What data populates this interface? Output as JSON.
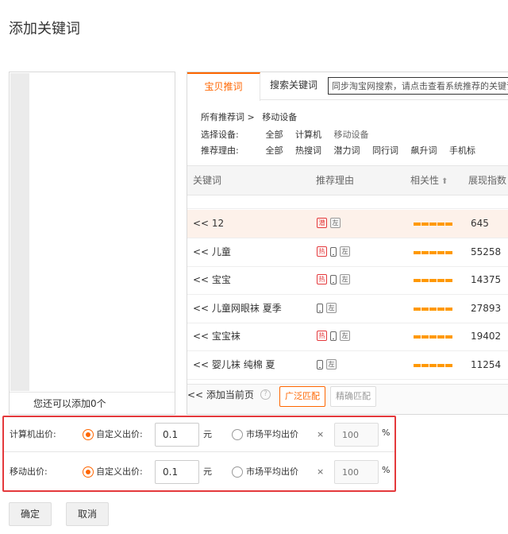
{
  "dialog": {
    "title": "添加关键词"
  },
  "left": {
    "footer": "您还可以添加0个"
  },
  "tabs": [
    {
      "label": "宝贝推词"
    },
    {
      "label": "搜索关键词"
    }
  ],
  "search": {
    "value": "同步淘宝网搜索，请点击查看系统推荐的关键词"
  },
  "filters": {
    "crumb_root": "所有推荐词 >",
    "crumb_current": "移动设备",
    "device_label": "选择设备:",
    "device_options": [
      "全部",
      "计算机",
      "移动设备"
    ],
    "reason_label": "推荐理由:",
    "reason_options": [
      "全部",
      "热搜词",
      "潜力词",
      "同行词",
      "飙升词",
      "手机标"
    ]
  },
  "table": {
    "headers": {
      "keyword": "关键词",
      "reason": "推荐理由",
      "relevance": "相关性",
      "index": "展现指数"
    },
    "rows": [
      {
        "keyword": "<< 12",
        "tags": [
          "潜",
          "左"
        ],
        "phone": false,
        "relevance": 5,
        "index": "645",
        "selected": true
      },
      {
        "keyword": "<< 儿童",
        "tags": [
          "热",
          "左"
        ],
        "phone": true,
        "relevance": 5,
        "index": "55258",
        "selected": false
      },
      {
        "keyword": "<< 宝宝",
        "tags": [
          "热",
          "左"
        ],
        "phone": true,
        "relevance": 5,
        "index": "14375",
        "selected": false
      },
      {
        "keyword": "<< 儿童网眼袜 夏季",
        "tags": [
          "左"
        ],
        "phone": true,
        "relevance": 5,
        "index": "27893",
        "selected": false
      },
      {
        "keyword": "<< 宝宝袜",
        "tags": [
          "热",
          "左"
        ],
        "phone": true,
        "relevance": 5,
        "index": "19402",
        "selected": false
      },
      {
        "keyword": "<< 婴儿袜 纯棉 夏",
        "tags": [
          "左"
        ],
        "phone": true,
        "relevance": 5,
        "index": "11254",
        "selected": false
      }
    ]
  },
  "bottom": {
    "add_page": "<<  添加当前页",
    "broad_match": "广泛匹配",
    "exact_match": "精确匹配"
  },
  "bids": [
    {
      "label": "计算机出价:",
      "custom_label": "自定义出价:",
      "price": "0.1",
      "unit": "元",
      "market_label": "市场平均出价",
      "times": "×",
      "percent_placeholder": "100",
      "percent_sign": "%",
      "custom_selected": true
    },
    {
      "label": "移动出价:",
      "custom_label": "自定义出价:",
      "price": "0.1",
      "unit": "元",
      "market_label": "市场平均出价",
      "times": "×",
      "percent_placeholder": "100",
      "percent_sign": "%",
      "custom_selected": true
    }
  ],
  "buttons": {
    "ok": "确定",
    "cancel": "取消"
  },
  "colors": {
    "accent": "#ff6600",
    "highlight_border": "#e4393c",
    "relevance_bar": "#ff9900"
  }
}
